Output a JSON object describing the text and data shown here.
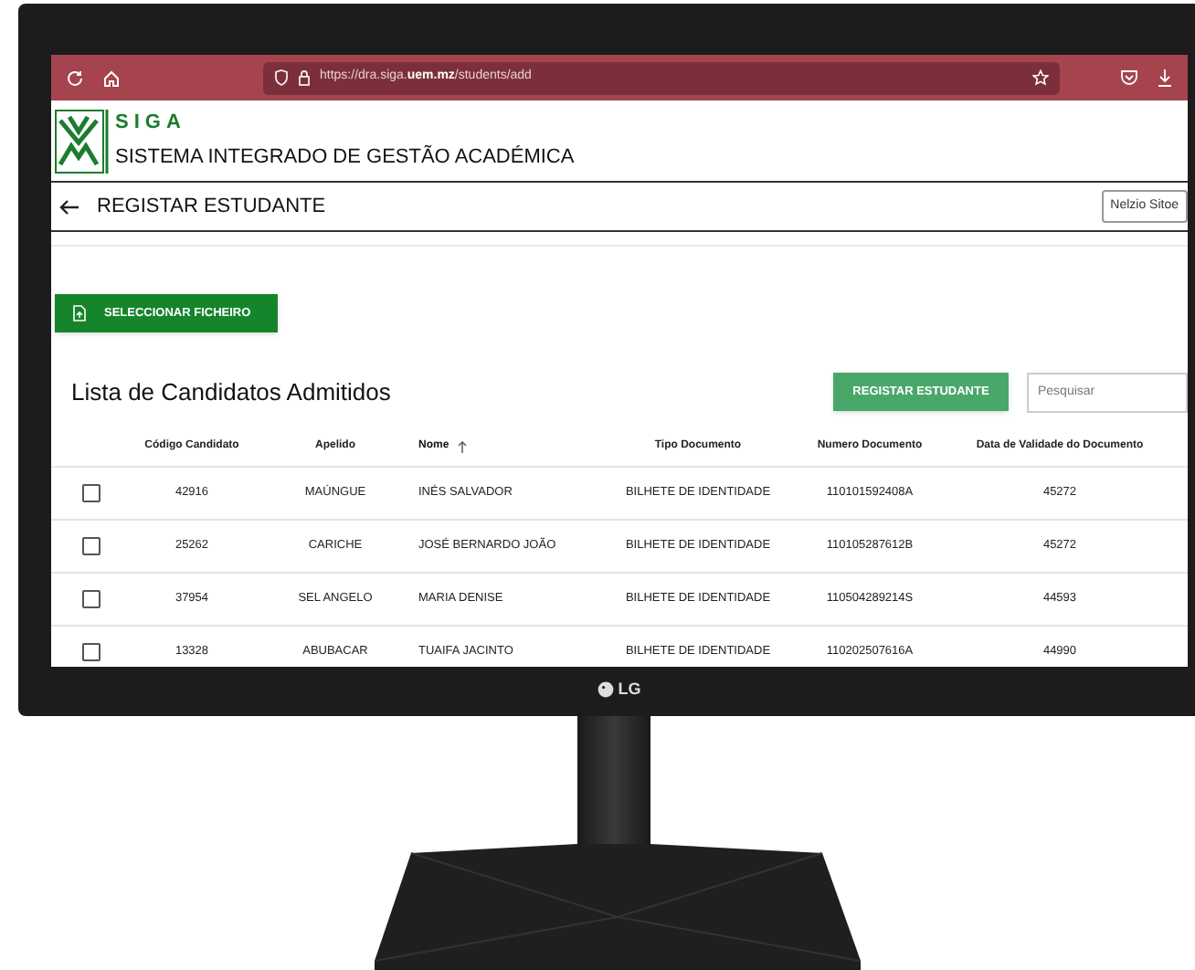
{
  "browser": {
    "url": "https://dra.siga.**uem.mz**/students/add"
  },
  "header": {
    "logo_text": "SIGA",
    "subtitle": "SISTEMA INTEGRADO DE GESTÃO ACADÉMICA"
  },
  "page_bar": {
    "title": "REGISTAR ESTUDANTE",
    "user": "Nelzio Sitoe"
  },
  "file_button": "SELECCIONAR FICHEIRO",
  "list": {
    "title": "Lista de Candidatos Admitidos",
    "register_button": "REGISTAR ESTUDANTE",
    "search": {
      "placeholder": "Pesquisar"
    }
  },
  "table": {
    "columns": [
      {
        "label": "Código Candidato",
        "sorted": false
      },
      {
        "label": "Apelido",
        "sorted": false
      },
      {
        "label": "Nome",
        "sorted": true
      },
      {
        "label": "Tipo Documento",
        "sorted": false
      },
      {
        "label": "Numero Documento",
        "sorted": false
      },
      {
        "label": "Data de Validade do Documento",
        "sorted": false
      }
    ],
    "rows": [
      {
        "checked": false,
        "cells": [
          "42916",
          "MAÚNGUE",
          "INÉS SALVADOR",
          "BILHETE DE IDENTIDADE",
          "110101592408A",
          "45272"
        ]
      },
      {
        "checked": false,
        "cells": [
          "25262",
          "CARICHE",
          "JOSÉ BERNARDO JOÃO",
          "BILHETE DE IDENTIDADE",
          "110105287612B",
          "45272"
        ]
      },
      {
        "checked": false,
        "cells": [
          "37954",
          "SEL ANGELO",
          "MARIA DENISE",
          "BILHETE DE IDENTIDADE",
          "110504289214S",
          "44593"
        ]
      },
      {
        "checked": false,
        "cells": [
          "13328",
          "ABUBACAR",
          "TUAIFA JACINTO",
          "BILHETE DE IDENTIDADE",
          "110202507616A",
          "44990"
        ]
      }
    ]
  },
  "monitor": {
    "brand": "LG"
  }
}
